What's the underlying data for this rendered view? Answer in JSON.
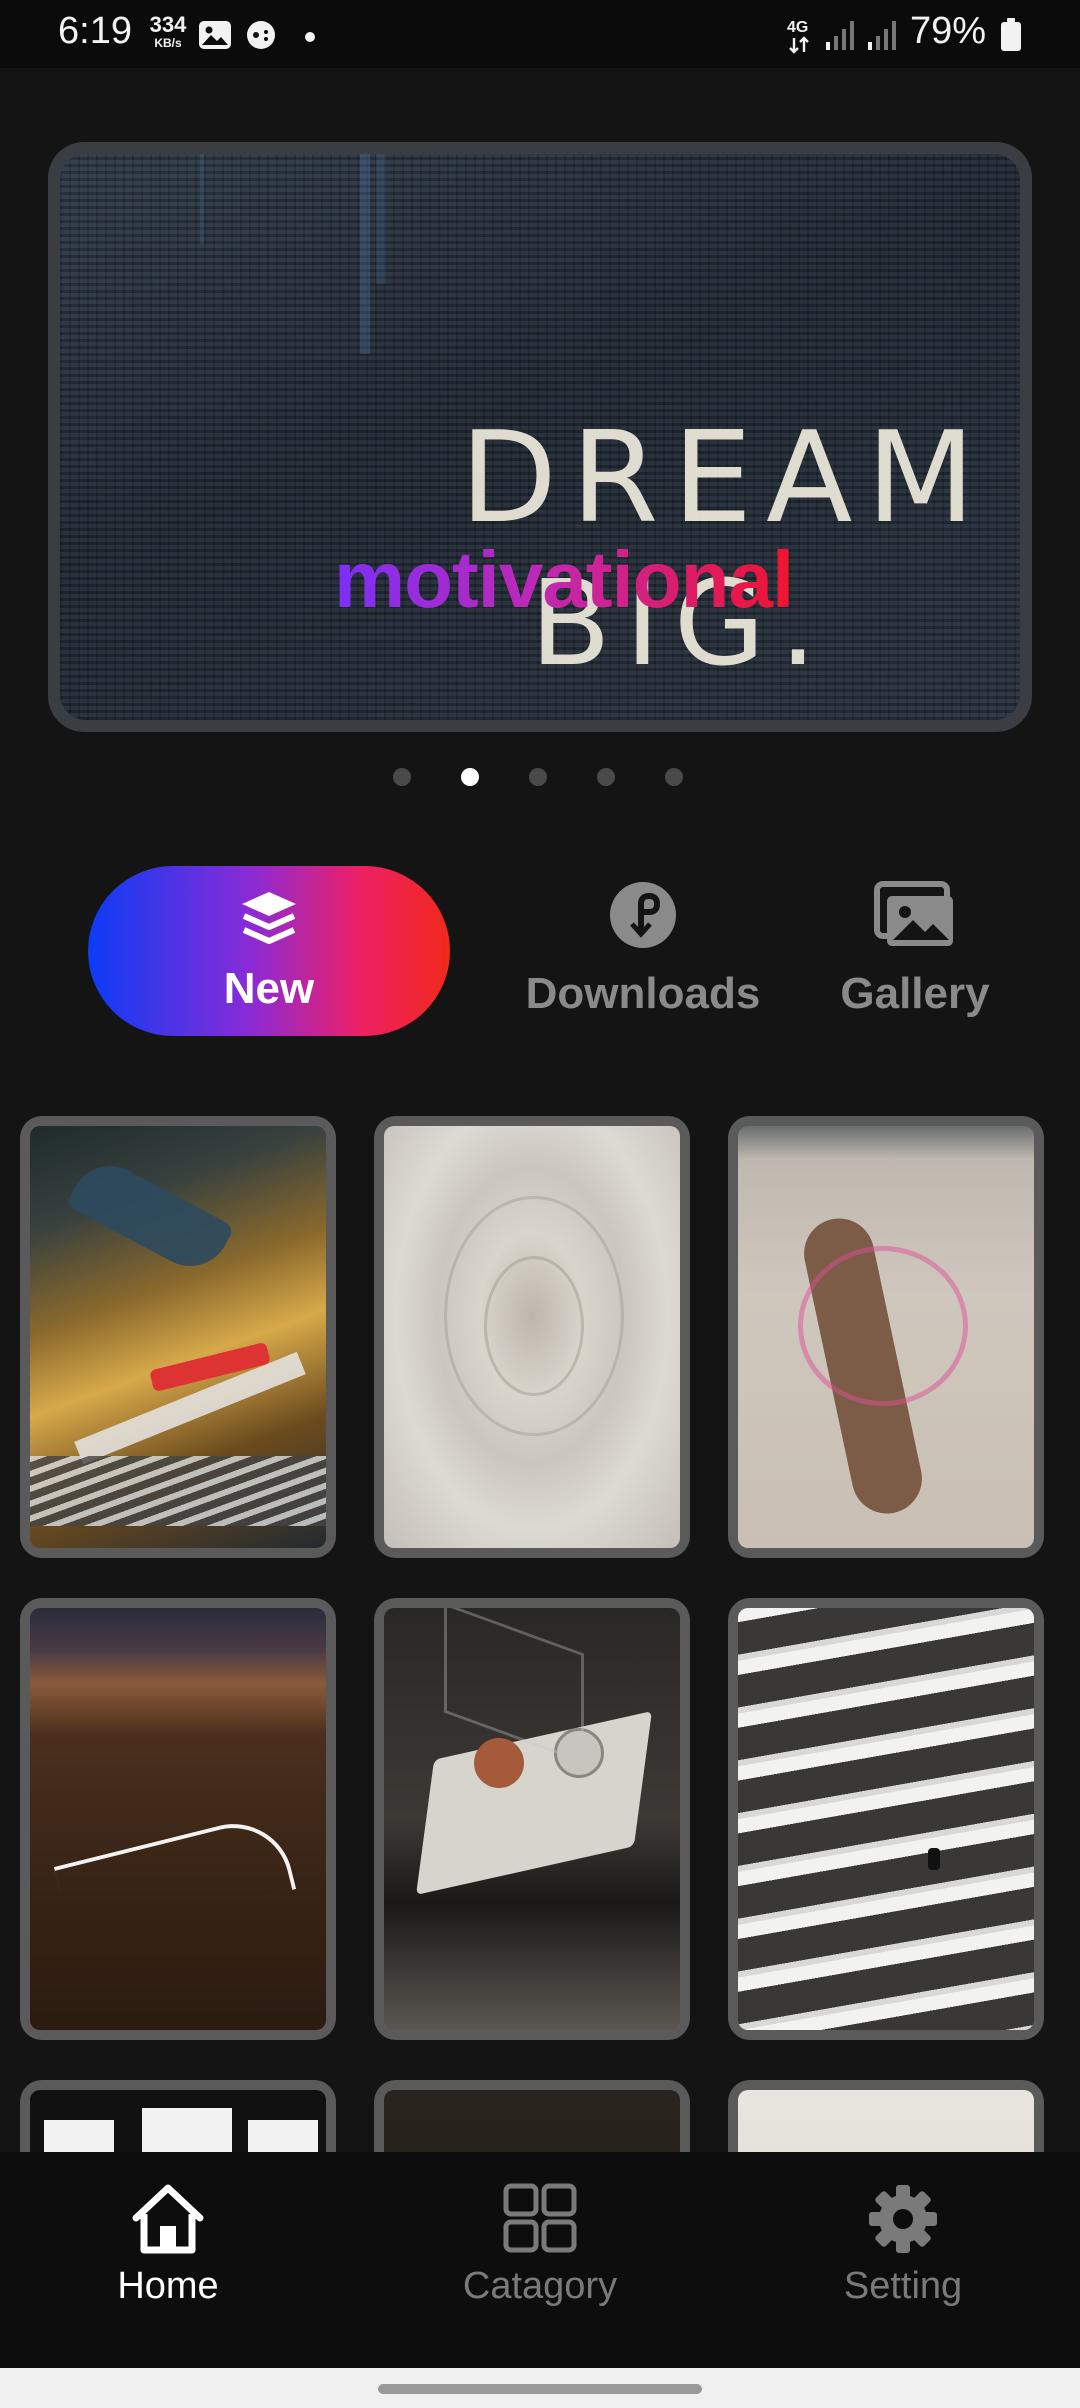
{
  "status_bar": {
    "time": "6:19",
    "net_speed_value": "334",
    "net_speed_unit": "KB/s",
    "network": "4G",
    "battery": "79%",
    "icons": [
      "gallery-notification-icon",
      "game-notification-icon",
      "dot-icon",
      "4g-icon",
      "signal-icon",
      "signal-icon",
      "battery-icon"
    ]
  },
  "banner": {
    "label": "motivational",
    "chalk_line1": "DREAM",
    "chalk_line2": "BIG.",
    "pages": 5,
    "active_page": 2
  },
  "tabs": {
    "new_label": "New",
    "downloads_label": "Downloads",
    "gallery_label": "Gallery",
    "active": "New"
  },
  "wallpapers": [
    {
      "subject": "car-hood-ornament"
    },
    {
      "subject": "white-rose"
    },
    {
      "subject": "aerial-beach"
    },
    {
      "subject": "canyon-road-night"
    },
    {
      "subject": "reel-to-reel-player"
    },
    {
      "subject": "building-balconies"
    },
    {
      "subject": "white-squares"
    },
    {
      "subject": "dark"
    },
    {
      "subject": "white-texture"
    }
  ],
  "bottom_nav": {
    "home_label": "Home",
    "category_label": "Catagory",
    "setting_label": "Setting",
    "active": "Home"
  },
  "colors": {
    "background": "#141414",
    "accent_gradient_start": "#0b3cf5",
    "accent_gradient_end": "#f02a1a",
    "inactive": "#8a8a8a"
  }
}
